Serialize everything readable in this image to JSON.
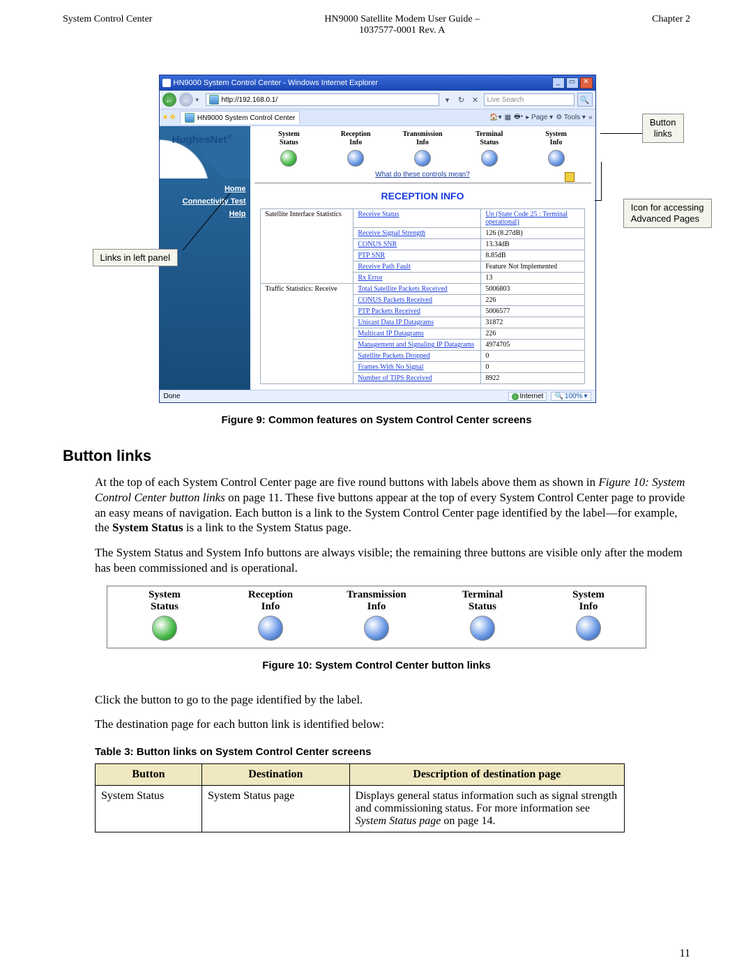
{
  "header": {
    "left": "System Control Center",
    "center1": "HN9000 Satellite Modem User Guide –",
    "center2": "1037577-0001 Rev. A",
    "right": "Chapter 2"
  },
  "browser": {
    "title": "HN9000 System Control Center - Windows Internet Explorer",
    "address": "http://192.168.0.1/",
    "tab": "HN9000 System Control Center",
    "search_placeholder": "Live Search",
    "tools": {
      "page": "Page",
      "tools": "Tools"
    },
    "brand": "HughesNet",
    "side_links": [
      "Home",
      "Connectivity Test",
      "Help"
    ],
    "buttons": [
      {
        "label1": "System",
        "label2": "Status",
        "color": "green"
      },
      {
        "label1": "Reception",
        "label2": "Info",
        "color": "blue"
      },
      {
        "label1": "Transmission",
        "label2": "Info",
        "color": "blue"
      },
      {
        "label1": "Terminal",
        "label2": "Status",
        "color": "blue"
      },
      {
        "label1": "System",
        "label2": "Info",
        "color": "blue"
      }
    ],
    "what_link": "What do these controls mean?",
    "section_title": "RECEPTION INFO",
    "group1_header": "Satellite Interface Statistics",
    "group2_header": "Traffic Statistics: Receive",
    "rows1": [
      {
        "p": "Receive Status",
        "v": "Up (State Code 25 : Terminal operational)"
      },
      {
        "p": "Receive Signal Strength",
        "v": "126 (8.27dB)"
      },
      {
        "p": "CONUS SNR",
        "v": "13.34dB"
      },
      {
        "p": "PTP SNR",
        "v": "8.85dB"
      },
      {
        "p": "Receive Path Fault",
        "v": "Feature Not Implemented"
      },
      {
        "p": "Rx Error",
        "v": "13"
      }
    ],
    "rows2": [
      {
        "p": "Total Satellite Packets Received",
        "v": "5006803"
      },
      {
        "p": "CONUS Packets Received",
        "v": "226"
      },
      {
        "p": "PTP Packets Received",
        "v": "5006577"
      },
      {
        "p": "Unicast Data IP Datagrams",
        "v": "31872"
      },
      {
        "p": "Multicast IP Datagrams",
        "v": "226"
      },
      {
        "p": "Management and Signaling IP Datagrams",
        "v": "4974705"
      },
      {
        "p": "Satellite Packets Dropped",
        "v": "0"
      },
      {
        "p": "Frames With No Signal",
        "v": "0"
      },
      {
        "p": "Number of TIPS Received",
        "v": "8922"
      }
    ],
    "status_done": "Done",
    "status_zone": "Internet",
    "status_zoom": "100%"
  },
  "callouts": {
    "button_links": "Button links",
    "adv_icon": "Icon for accessing Advanced Pages",
    "left_panel": "Links in left panel"
  },
  "fig9_caption": "Figure 9: Common features on System Control Center screens",
  "section_heading": "Button links",
  "para1a": "At the top of each System Control Center page are five round buttons with labels above them as shown in ",
  "para1b": "Figure 10: System Control Center button links",
  "para1c": " on page 11. These five buttons appear at the top of every System Control Center page to provide an easy means of navigation. Each button is a link to the System Control Center page identified by the label—for example, the ",
  "para1d": "System Status",
  "para1e": " is a link to the System Status page.",
  "para2": "The System Status and System Info buttons are always visible; the remaining three buttons are visible only after the modem has been commissioned and is operational.",
  "fig10_caption": "Figure 10: System Control Center button links",
  "para3": "Click the button to go to the page identified by the label.",
  "para4": "The destination page for each button link is identified below:",
  "table3_caption": "Table 3: Button links on System Control Center screens",
  "table3": {
    "headers": [
      "Button",
      "Destination",
      "Description of destination page"
    ],
    "row": {
      "button": "System Status",
      "dest": "System Status page",
      "desc_a": "Displays general status information such as signal strength and commissioning status. For more information see ",
      "desc_b": "System Status page",
      "desc_c": " on page 14."
    }
  },
  "page_number": "11"
}
